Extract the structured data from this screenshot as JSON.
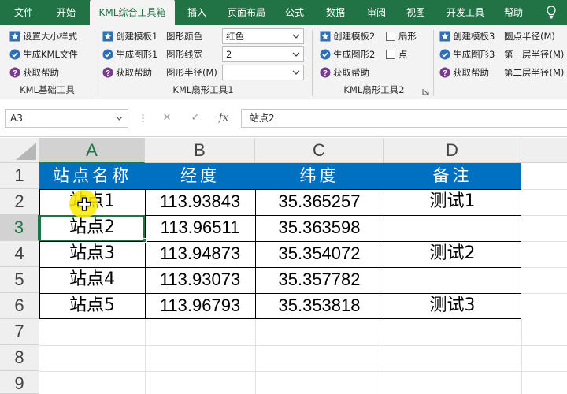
{
  "tabs": [
    {
      "label": "文件",
      "active": false
    },
    {
      "label": "开始",
      "active": false
    },
    {
      "label": "KML综合工具箱",
      "active": true
    },
    {
      "label": "插入",
      "active": false
    },
    {
      "label": "页面布局",
      "active": false
    },
    {
      "label": "公式",
      "active": false
    },
    {
      "label": "数据",
      "active": false
    },
    {
      "label": "审阅",
      "active": false
    },
    {
      "label": "视图",
      "active": false
    },
    {
      "label": "开发工具",
      "active": false
    },
    {
      "label": "帮助",
      "active": false
    }
  ],
  "ribbon": {
    "group1": {
      "label": "KML基础工具",
      "set_size": "设置大小样式",
      "gen_kml": "生成KML文件",
      "help": "获取帮助"
    },
    "group2": {
      "label": "KML扇形工具1",
      "create_template": "创建模板1",
      "gen_shape": "生成图形1",
      "help": "获取帮助",
      "color_label": "图形颜色",
      "color_value": "红色",
      "width_label": "图形线宽",
      "width_value": "2",
      "radius_label": "图形半径(M)",
      "radius_value": ""
    },
    "group3": {
      "label": "KML扇形工具2",
      "create_template": "创建模板2",
      "gen_shape": "生成图形2",
      "help": "获取帮助",
      "sector": "扇形",
      "point": "点"
    },
    "group4": {
      "create_template": "创建模板3",
      "gen_shape": "生成图形3",
      "help": "获取帮助",
      "circle_radius": "圆点半径(M)",
      "layer1_radius": "第一层半径(M)",
      "layer2_radius": "第二层半径(M)"
    }
  },
  "formula_bar": {
    "name_box": "A3",
    "cancel": "✕",
    "enter": "✓",
    "fx": "fx",
    "content": "站点2"
  },
  "columns": [
    "A",
    "B",
    "C",
    "D"
  ],
  "selected_column": "A",
  "rows": [
    "1",
    "2",
    "3",
    "4",
    "5",
    "6",
    "7",
    "8",
    "9"
  ],
  "selected_row": "3",
  "sheet": {
    "headers": [
      "站点名称",
      "经度",
      "纬度",
      "备注"
    ],
    "data": [
      [
        "站点1",
        "113.93843",
        "35.365257",
        "测试1"
      ],
      [
        "站点2",
        "113.96511",
        "35.363598",
        ""
      ],
      [
        "站点3",
        "113.94873",
        "35.354072",
        "测试2"
      ],
      [
        "站点4",
        "113.93073",
        "35.357782",
        ""
      ],
      [
        "站点5",
        "113.96793",
        "35.353818",
        "测试3"
      ]
    ]
  },
  "colors": {
    "excel_green": "#217346",
    "header_fill": "#0070c0",
    "cursor_highlight": "#ffeb00"
  }
}
